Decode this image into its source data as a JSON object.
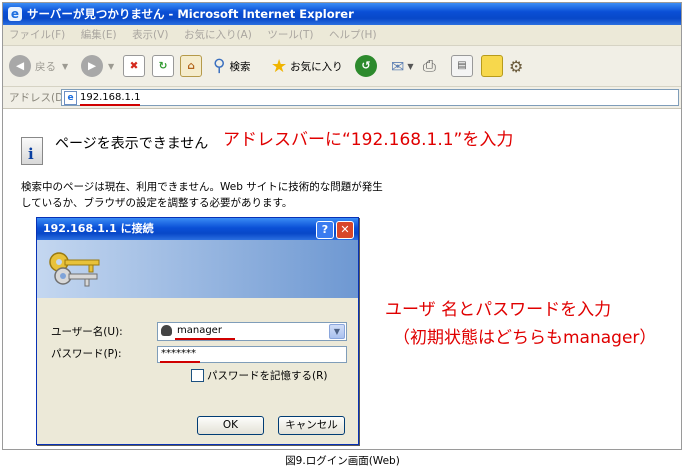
{
  "window": {
    "title": "サーバーが見つかりません - Microsoft Internet Explorer"
  },
  "menubar": [
    "ファイル(F)",
    "編集(E)",
    "表示(V)",
    "お気に入り(A)",
    "ツール(T)",
    "ヘルプ(H)"
  ],
  "toolbar": {
    "back_label": "戻る",
    "search_label": "検索",
    "favorites_label": "お気に入り"
  },
  "addressbar": {
    "label": "アドレス(D)",
    "url": "192.168.1.1"
  },
  "error_page": {
    "title": "ページを表示できません",
    "body": "検索中のページは現在、利用できません。Web サイトに技術的な問題が発生しているか、ブラウザの設定を調整する必要があります。"
  },
  "annotations": {
    "address_note": "アドレスバーに“192.168.1.1”を入力",
    "login_note_line1": "ユーザ 名とパスワードを入力",
    "login_note_line2": "（初期状態はどちらもmanager）"
  },
  "login_dialog": {
    "title": "192.168.1.1 に接続",
    "username_label": "ユーザー名(U):",
    "username_value": "manager",
    "password_label": "パスワード(P):",
    "password_value": "*******",
    "remember_label": "パスワードを記憶する(R)",
    "remember_checked": false,
    "ok_label": "OK",
    "cancel_label": "キャンセル"
  },
  "caption": "図9.ログイン画面(Web)",
  "colors": {
    "annotation_red": "#e00000",
    "xp_blue": "#0a4fd6"
  }
}
